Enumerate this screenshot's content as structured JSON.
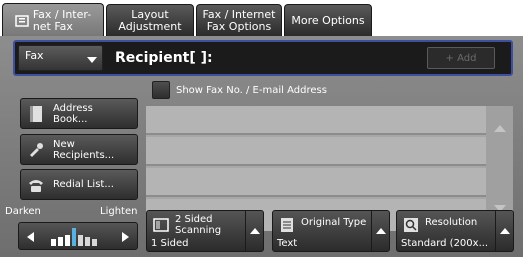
{
  "tabs": [
    {
      "label": "Fax / Inter-\nnet Fax",
      "icon": "fax-icon"
    },
    {
      "label": "Layout\nAdjustment"
    },
    {
      "label": "Fax / Internet\nFax Options"
    },
    {
      "label": "More Options"
    }
  ],
  "recipient": {
    "fax_select": "Fax",
    "label": "Recipient[   ]:",
    "add_button": "+ Add"
  },
  "show_fax": {
    "label": "Show Fax No. / E-mail Address"
  },
  "side_buttons": {
    "address_book": "Address\nBook...",
    "new_recipients": "New\nRecipients...",
    "redial_list": "Redial List..."
  },
  "density": {
    "darken": "Darken",
    "lighten": "Lighten"
  },
  "features": {
    "two_sided": {
      "name": "2 Sided\nScanning",
      "value": "1 Sided"
    },
    "original_type": {
      "name": "Original Type",
      "value": "Text"
    },
    "resolution": {
      "name": "Resolution",
      "value": "Standard (200x..."
    }
  },
  "colors": {
    "accent": "#3d4f9e",
    "panel": "#7e7e7e"
  }
}
